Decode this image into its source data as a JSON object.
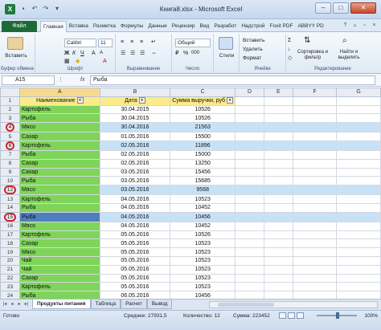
{
  "window": {
    "title": "Книга8.xlsx - Microsoft Excel",
    "app_icon": "X",
    "buttons": {
      "minimize": "–",
      "maximize": "□",
      "close": "✕"
    }
  },
  "qat": {
    "save_icon": "save-icon",
    "undo_icon": "undo-icon",
    "redo_icon": "redo-icon"
  },
  "tabs": {
    "file": "Файл",
    "items": [
      "Главная",
      "Вставка",
      "Разметка",
      "Формулы",
      "Данные",
      "Рецензир",
      "Вид",
      "Разработ",
      "Надстрой",
      "Foxit PDF",
      "ABBYY PD"
    ],
    "active_index": 0
  },
  "ribbon": {
    "clipboard": {
      "paste": "Вставить",
      "label": "Буфер обмена"
    },
    "font": {
      "name": "Calibri",
      "size": "11",
      "bold": "Ж",
      "italic": "К",
      "underline": "Ч",
      "grow": "A",
      "shrink": "A",
      "color": "A",
      "label": "Шрифт"
    },
    "alignment": {
      "label": "Выравнивание"
    },
    "number": {
      "format": "Общий",
      "percent": "%",
      "thousands": "000",
      "currency": "₽",
      "label": "Число"
    },
    "styles": {
      "button": "Стили"
    },
    "cells": {
      "insert": "Вставить",
      "delete": "Удалить",
      "format": "Формат",
      "label": "Ячейки"
    },
    "editing": {
      "sort": "Сортировка и фильтр",
      "find": "Найти и выделить",
      "label": "Редактирование"
    }
  },
  "formula_bar": {
    "name_box": "A15",
    "fx": "fx",
    "value": "Рыба"
  },
  "grid": {
    "col_letters": [
      "A",
      "B",
      "C",
      "D",
      "E",
      "F",
      "G"
    ],
    "headers": [
      "Наименование",
      "Дата",
      "Сумма выручки, руб"
    ],
    "rows": [
      {
        "n": "1",
        "a": "Наименование",
        "b": "Дата",
        "c": "Сумма выручки, руб",
        "header": true
      },
      {
        "n": "2",
        "a": "Картофель",
        "b": "30.04.2015",
        "c": "10526"
      },
      {
        "n": "3",
        "a": "Рыба",
        "b": "30.04.2015",
        "c": "10526"
      },
      {
        "n": "4",
        "a": "Мясо",
        "b": "30.04.2016",
        "c": "21563",
        "hl": true,
        "circle": true
      },
      {
        "n": "5",
        "a": "Сахар",
        "b": "01.05.2016",
        "c": "15500"
      },
      {
        "n": "6",
        "a": "Картофель",
        "b": "02.05.2016",
        "c": "11896",
        "hl": true,
        "circle": true
      },
      {
        "n": "7",
        "a": "Рыба",
        "b": "02.05.2016",
        "c": "15000"
      },
      {
        "n": "8",
        "a": "Сахар",
        "b": "02.05.2016",
        "c": "13250"
      },
      {
        "n": "9",
        "a": "Сахар",
        "b": "03.05.2016",
        "c": "15456"
      },
      {
        "n": "10",
        "a": "Рыба",
        "b": "03.05.2016",
        "c": "15685"
      },
      {
        "n": "12",
        "a": "Мясо",
        "b": "03.05.2016",
        "c": "9568",
        "hl": true,
        "circle": true
      },
      {
        "n": "13",
        "a": "Картофель",
        "b": "04.05.2016",
        "c": "10523"
      },
      {
        "n": "14",
        "a": "Рыба",
        "b": "04.05.2016",
        "c": "10452"
      },
      {
        "n": "15",
        "a": "Рыба",
        "b": "04.05.2016",
        "c": "10456",
        "hl": true,
        "circle": true,
        "sel": true
      },
      {
        "n": "16",
        "a": "Мясо",
        "b": "04.05.2016",
        "c": "10452"
      },
      {
        "n": "17",
        "a": "Картофель",
        "b": "05.05.2016",
        "c": "10526"
      },
      {
        "n": "18",
        "a": "Сахар",
        "b": "05.05.2016",
        "c": "10523"
      },
      {
        "n": "19",
        "a": "Мясо",
        "b": "05.05.2016",
        "c": "10523"
      },
      {
        "n": "20",
        "a": "Чай",
        "b": "05.05.2016",
        "c": "10523"
      },
      {
        "n": "21",
        "a": "Чай",
        "b": "05.05.2016",
        "c": "10523"
      },
      {
        "n": "22",
        "a": "Сахар",
        "b": "05.05.2016",
        "c": "10523"
      },
      {
        "n": "23",
        "a": "Картофель",
        "b": "05.05.2016",
        "c": "10523"
      },
      {
        "n": "24",
        "a": "Рыба",
        "b": "06.05.2016",
        "c": "10456"
      }
    ]
  },
  "sheets": {
    "tabs": [
      "Продукты питания",
      "Таблица",
      "Расчет",
      "Вывод"
    ],
    "active_index": 0
  },
  "status": {
    "ready": "Готово",
    "average": "Среднее: 27931,5",
    "count": "Количество: 12",
    "sum": "Сумма: 223452",
    "zoom": "100%"
  }
}
